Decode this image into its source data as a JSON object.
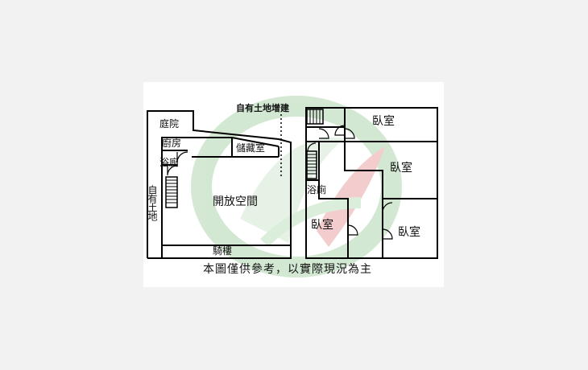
{
  "labels": {
    "courtyard": "庭院",
    "own_land_extension": "自有土地增建",
    "kitchen": "廚房",
    "storage_room": "儲藏室",
    "bathroom_left": "浴廁",
    "own_land": "自有土地",
    "open_space": "開放空間",
    "arcade": "騎樓",
    "bedroom_top": "臥室",
    "bedroom_mid": "臥室",
    "bathroom_right": "浴廁",
    "bedroom_bottom_left": "臥室",
    "bedroom_bottom_right": "臥室"
  },
  "caption": "本圖僅供參考，以實際現況為主",
  "colors": {
    "wall": "#000000",
    "watermark_green": "#cfe6cf",
    "watermark_red": "#f2c8c8",
    "background": "#f2f2f2"
  }
}
